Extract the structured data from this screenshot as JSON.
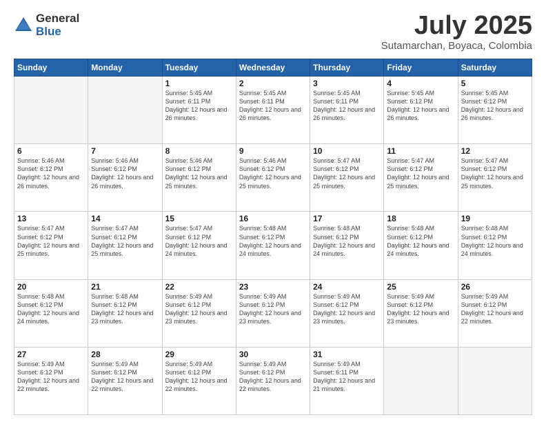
{
  "logo": {
    "general": "General",
    "blue": "Blue"
  },
  "header": {
    "month_year": "July 2025",
    "location": "Sutamarchan, Boyaca, Colombia"
  },
  "days_of_week": [
    "Sunday",
    "Monday",
    "Tuesday",
    "Wednesday",
    "Thursday",
    "Friday",
    "Saturday"
  ],
  "weeks": [
    [
      {
        "day": "",
        "info": ""
      },
      {
        "day": "",
        "info": ""
      },
      {
        "day": "1",
        "info": "Sunrise: 5:45 AM\nSunset: 6:11 PM\nDaylight: 12 hours and 26 minutes."
      },
      {
        "day": "2",
        "info": "Sunrise: 5:45 AM\nSunset: 6:11 PM\nDaylight: 12 hours and 26 minutes."
      },
      {
        "day": "3",
        "info": "Sunrise: 5:45 AM\nSunset: 6:11 PM\nDaylight: 12 hours and 26 minutes."
      },
      {
        "day": "4",
        "info": "Sunrise: 5:45 AM\nSunset: 6:12 PM\nDaylight: 12 hours and 26 minutes."
      },
      {
        "day": "5",
        "info": "Sunrise: 5:45 AM\nSunset: 6:12 PM\nDaylight: 12 hours and 26 minutes."
      }
    ],
    [
      {
        "day": "6",
        "info": "Sunrise: 5:46 AM\nSunset: 6:12 PM\nDaylight: 12 hours and 26 minutes."
      },
      {
        "day": "7",
        "info": "Sunrise: 5:46 AM\nSunset: 6:12 PM\nDaylight: 12 hours and 26 minutes."
      },
      {
        "day": "8",
        "info": "Sunrise: 5:46 AM\nSunset: 6:12 PM\nDaylight: 12 hours and 25 minutes."
      },
      {
        "day": "9",
        "info": "Sunrise: 5:46 AM\nSunset: 6:12 PM\nDaylight: 12 hours and 25 minutes."
      },
      {
        "day": "10",
        "info": "Sunrise: 5:47 AM\nSunset: 6:12 PM\nDaylight: 12 hours and 25 minutes."
      },
      {
        "day": "11",
        "info": "Sunrise: 5:47 AM\nSunset: 6:12 PM\nDaylight: 12 hours and 25 minutes."
      },
      {
        "day": "12",
        "info": "Sunrise: 5:47 AM\nSunset: 6:12 PM\nDaylight: 12 hours and 25 minutes."
      }
    ],
    [
      {
        "day": "13",
        "info": "Sunrise: 5:47 AM\nSunset: 6:12 PM\nDaylight: 12 hours and 25 minutes."
      },
      {
        "day": "14",
        "info": "Sunrise: 5:47 AM\nSunset: 6:12 PM\nDaylight: 12 hours and 25 minutes."
      },
      {
        "day": "15",
        "info": "Sunrise: 5:47 AM\nSunset: 6:12 PM\nDaylight: 12 hours and 24 minutes."
      },
      {
        "day": "16",
        "info": "Sunrise: 5:48 AM\nSunset: 6:12 PM\nDaylight: 12 hours and 24 minutes."
      },
      {
        "day": "17",
        "info": "Sunrise: 5:48 AM\nSunset: 6:12 PM\nDaylight: 12 hours and 24 minutes."
      },
      {
        "day": "18",
        "info": "Sunrise: 5:48 AM\nSunset: 6:12 PM\nDaylight: 12 hours and 24 minutes."
      },
      {
        "day": "19",
        "info": "Sunrise: 5:48 AM\nSunset: 6:12 PM\nDaylight: 12 hours and 24 minutes."
      }
    ],
    [
      {
        "day": "20",
        "info": "Sunrise: 5:48 AM\nSunset: 6:12 PM\nDaylight: 12 hours and 24 minutes."
      },
      {
        "day": "21",
        "info": "Sunrise: 5:48 AM\nSunset: 6:12 PM\nDaylight: 12 hours and 23 minutes."
      },
      {
        "day": "22",
        "info": "Sunrise: 5:49 AM\nSunset: 6:12 PM\nDaylight: 12 hours and 23 minutes."
      },
      {
        "day": "23",
        "info": "Sunrise: 5:49 AM\nSunset: 6:12 PM\nDaylight: 12 hours and 23 minutes."
      },
      {
        "day": "24",
        "info": "Sunrise: 5:49 AM\nSunset: 6:12 PM\nDaylight: 12 hours and 23 minutes."
      },
      {
        "day": "25",
        "info": "Sunrise: 5:49 AM\nSunset: 6:12 PM\nDaylight: 12 hours and 23 minutes."
      },
      {
        "day": "26",
        "info": "Sunrise: 5:49 AM\nSunset: 6:12 PM\nDaylight: 12 hours and 22 minutes."
      }
    ],
    [
      {
        "day": "27",
        "info": "Sunrise: 5:49 AM\nSunset: 6:12 PM\nDaylight: 12 hours and 22 minutes."
      },
      {
        "day": "28",
        "info": "Sunrise: 5:49 AM\nSunset: 6:12 PM\nDaylight: 12 hours and 22 minutes."
      },
      {
        "day": "29",
        "info": "Sunrise: 5:49 AM\nSunset: 6:12 PM\nDaylight: 12 hours and 22 minutes."
      },
      {
        "day": "30",
        "info": "Sunrise: 5:49 AM\nSunset: 6:12 PM\nDaylight: 12 hours and 22 minutes."
      },
      {
        "day": "31",
        "info": "Sunrise: 5:49 AM\nSunset: 6:11 PM\nDaylight: 12 hours and 21 minutes."
      },
      {
        "day": "",
        "info": ""
      },
      {
        "day": "",
        "info": ""
      }
    ]
  ]
}
